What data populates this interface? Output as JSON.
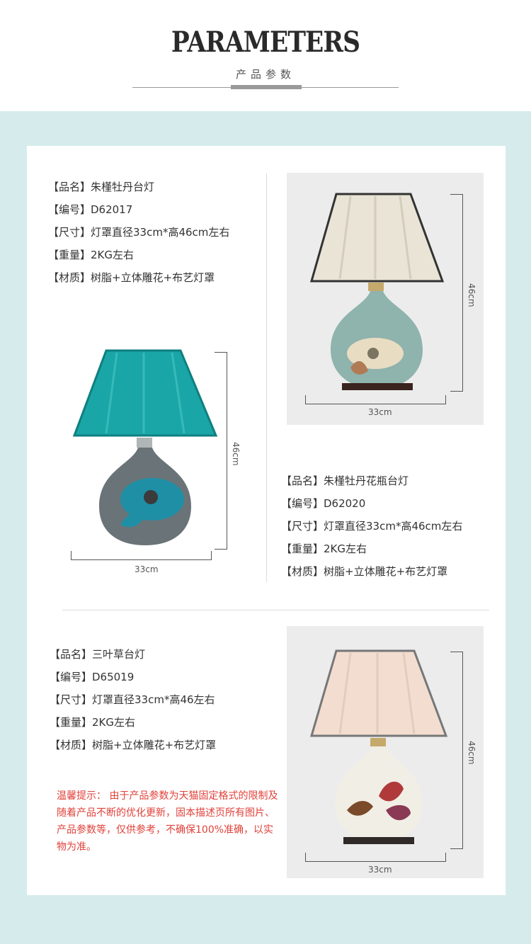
{
  "header": {
    "title": "PARAMETERS",
    "subtitle": "产品参数"
  },
  "products": [
    {
      "name": "【品名】朱槿牡丹台灯",
      "code": "【编号】D62017",
      "size": "【尺寸】灯罩直径33cm*高46cm左右",
      "weight": "【重量】2KG左右",
      "material": "【材质】树脂+立体雕花+布艺灯罩",
      "width_label": "33cm",
      "height_label": "46cm"
    },
    {
      "name": "【品名】朱槿牡丹花瓶台灯",
      "code": "【编号】D62020",
      "size": "【尺寸】灯罩直径33cm*高46cm左右",
      "weight": "【重量】2KG左右",
      "material": "【材质】树脂+立体雕花+布艺灯罩",
      "width_label": "33cm",
      "height_label": "46cm"
    },
    {
      "name": "【品名】三叶草台灯",
      "code": "【编号】D65019",
      "size": "【尺寸】灯罩直径33cm*高46左右",
      "weight": "【重量】2KG左右",
      "material": "【材质】树脂+立体雕花+布艺灯罩",
      "width_label": "33cm",
      "height_label": "46cm"
    }
  ],
  "notice": "温馨提示：  由于产品参数为天猫固定格式的限制及随着产品不断的优化更新，固本描述页所有图片、产品参数等，仅供参考，不确保100%准确，以实物为准。",
  "colors": {
    "band": "#d6ecec",
    "notice": "#e0413a",
    "teal_shade": "#1aa6a6",
    "cream_shade": "#e9e4d6",
    "pink_shade": "#f2ddd0"
  }
}
